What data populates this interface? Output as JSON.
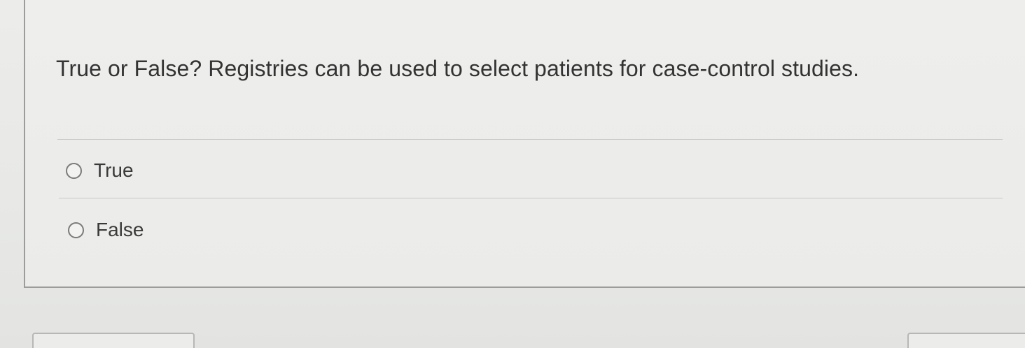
{
  "question": {
    "text": "True or False? Registries can be used to select patients for case-control studies."
  },
  "options": [
    {
      "label": "True",
      "selected": false
    },
    {
      "label": "False",
      "selected": false
    }
  ],
  "colors": {
    "background": "#e9eae8",
    "text": "#333333",
    "border": "#9c9d9b"
  }
}
